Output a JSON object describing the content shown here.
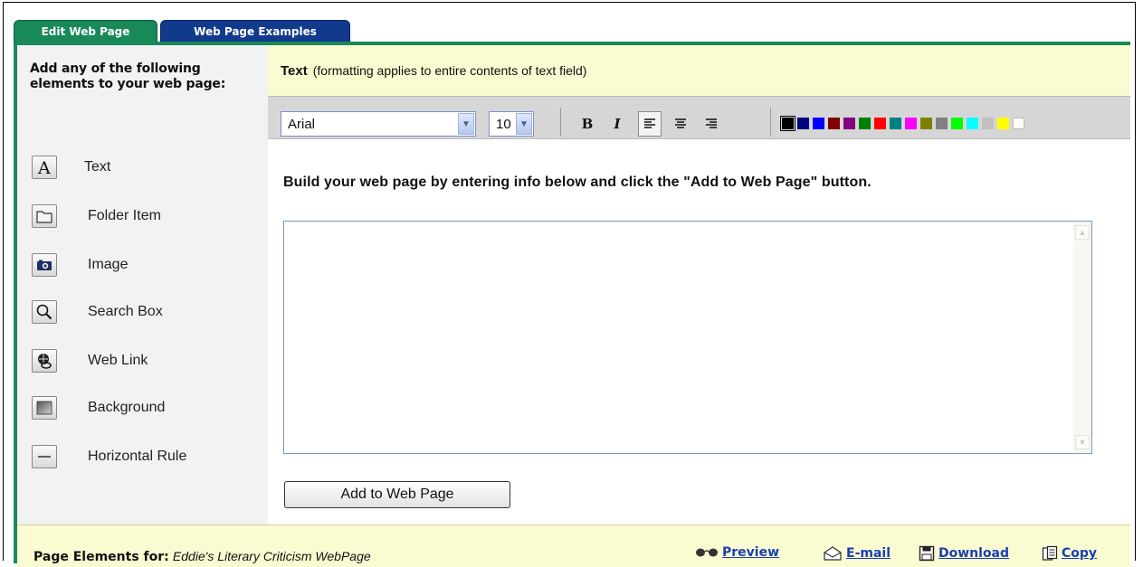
{
  "tabs": [
    {
      "label": "Edit Web Page"
    },
    {
      "label": "Web Page Examples"
    }
  ],
  "sidebar": {
    "title": "Add any of the following elements to your web page:",
    "items": [
      {
        "label": "Text",
        "icon": "text-A-icon"
      },
      {
        "label": "Folder Item",
        "icon": "folder-icon"
      },
      {
        "label": "Image",
        "icon": "camera-icon"
      },
      {
        "label": "Search Box",
        "icon": "magnifier-icon"
      },
      {
        "label": "Web Link",
        "icon": "web-link-icon"
      },
      {
        "label": "Background",
        "icon": "background-icon"
      },
      {
        "label": "Horizontal Rule",
        "icon": "horizontal-rule-icon"
      }
    ]
  },
  "main": {
    "section_title": "Text",
    "section_note": "(formatting applies to entire contents of text field)",
    "instruction": "Build your web page by entering info below and click the \"Add to Web Page\" button.",
    "textarea_value": "",
    "add_button": "Add to Web Page"
  },
  "toolbar": {
    "font": "Arial",
    "size": "10",
    "bold": "B",
    "italic": "I",
    "colors": [
      "#000000",
      "#000080",
      "#0000ff",
      "#800000",
      "#800080",
      "#008000",
      "#ff0000",
      "#008080",
      "#ff00ff",
      "#808000",
      "#808080",
      "#00ff00",
      "#00ffff",
      "#c0c0c0",
      "#ffff00",
      "#ffffff"
    ]
  },
  "footer": {
    "label": "Page Elements for:",
    "page_name": "Eddie's Literary Criticism WebPage",
    "actions": [
      {
        "label": "Preview",
        "icon": "glasses-icon"
      },
      {
        "label": "E-mail",
        "icon": "envelope-icon"
      },
      {
        "label": "Download",
        "icon": "floppy-disk-icon"
      },
      {
        "label": "Copy",
        "icon": "copy-icon"
      }
    ]
  },
  "colors": {
    "accent_green": "#19895a",
    "accent_blue": "#123a8c",
    "header_yellow": "#fbfbd2",
    "link_blue": "#1a3fb4"
  }
}
